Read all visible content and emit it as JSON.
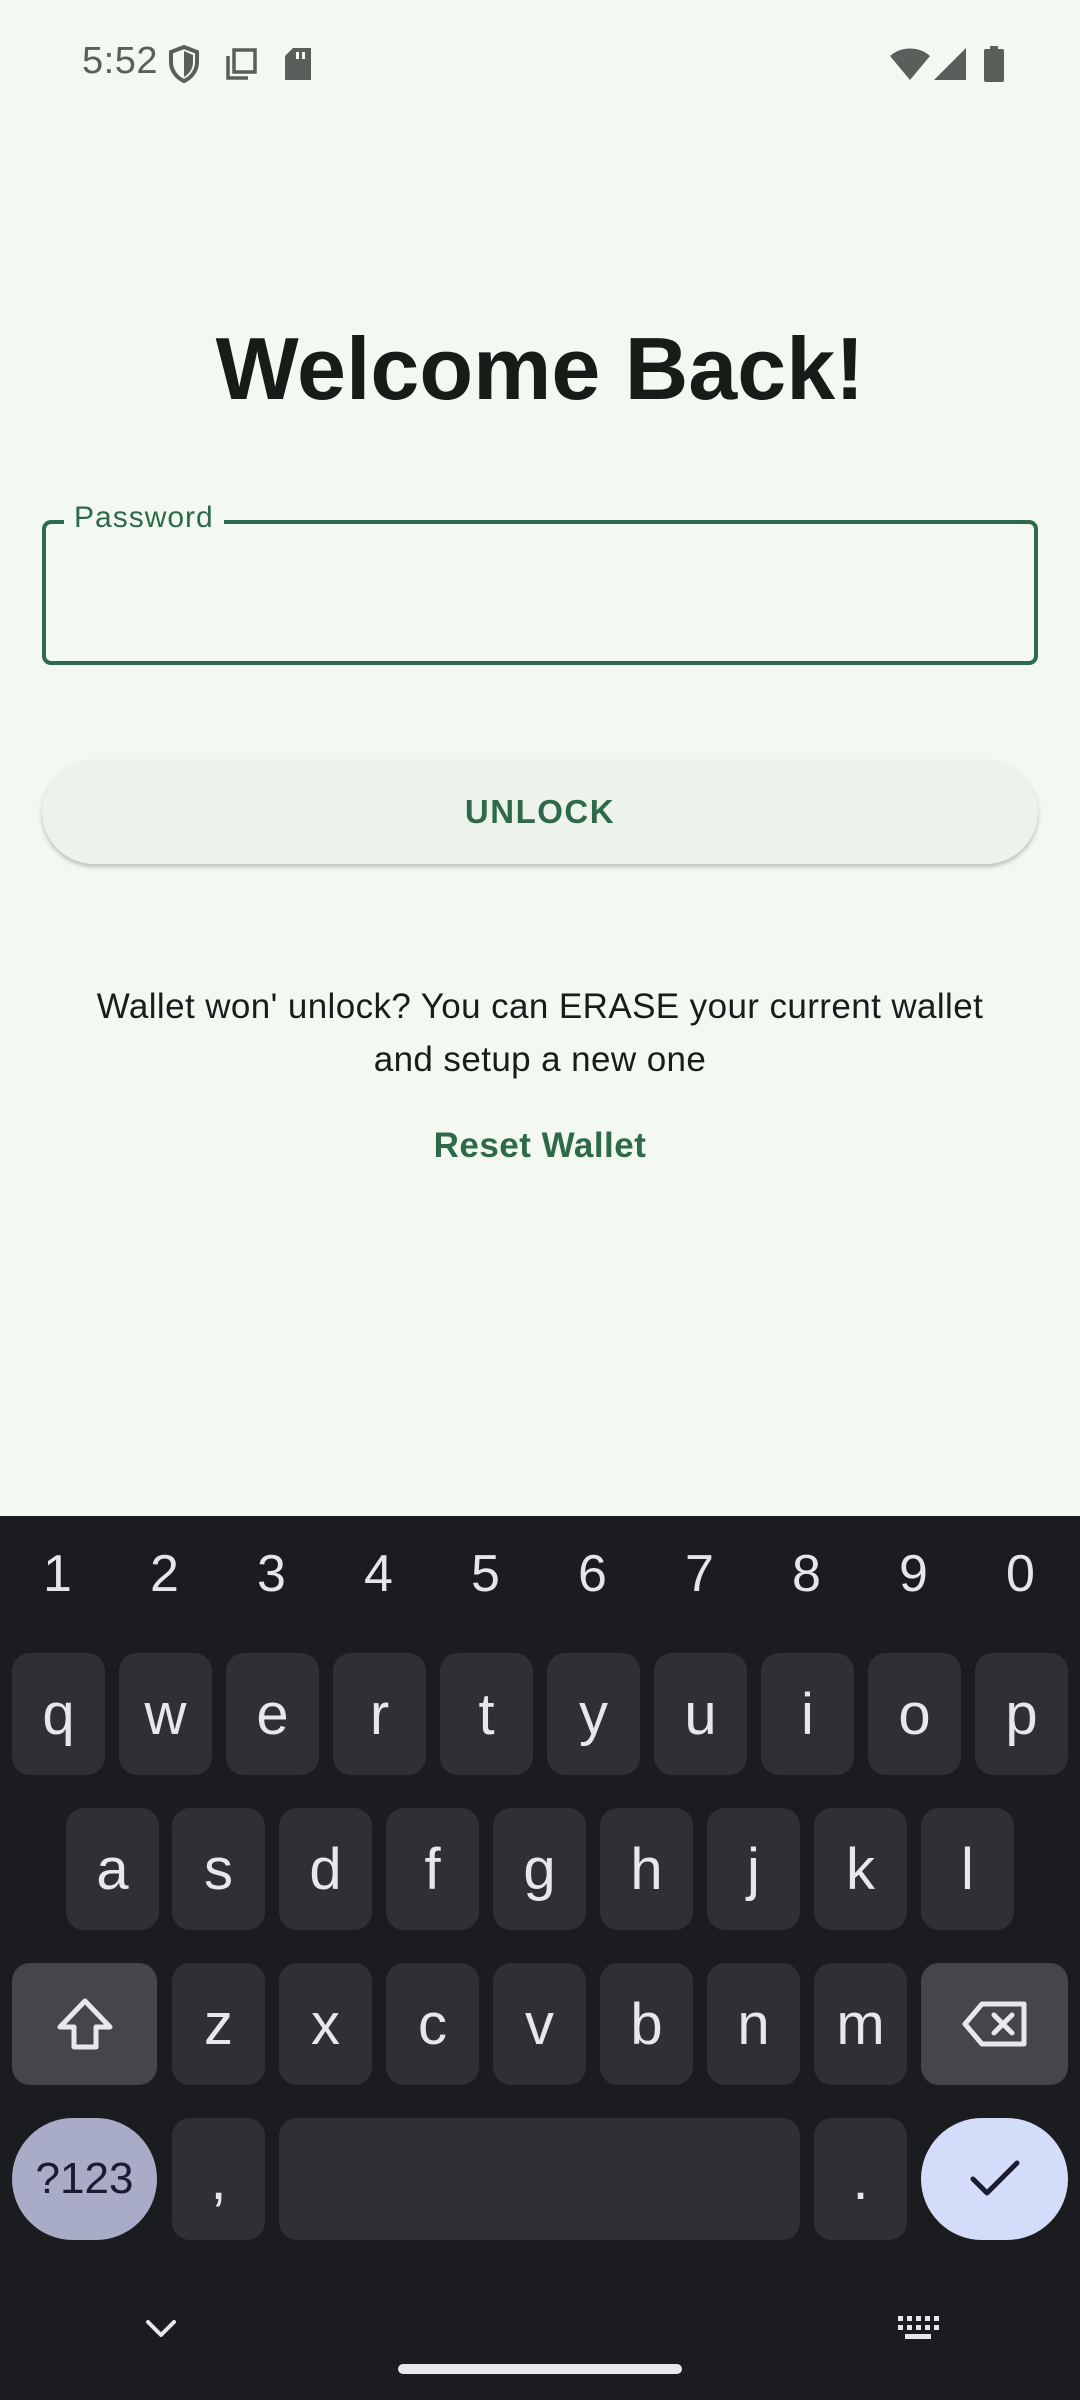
{
  "status_bar": {
    "time": "5:52",
    "left_icons": [
      "shield-icon",
      "copy-icon",
      "sd-card-icon"
    ],
    "right_icons": [
      "wifi-icon",
      "signal-icon",
      "battery-icon"
    ]
  },
  "screen": {
    "title": "Welcome Back!",
    "password_label": "Password",
    "password_value": "",
    "unlock_label": "UNLOCK",
    "info_line1": "Wallet won' unlock? You can ERASE your current wallet",
    "info_line2": "and setup a new one",
    "reset_label": "Reset Wallet"
  },
  "keyboard": {
    "numbers": [
      "1",
      "2",
      "3",
      "4",
      "5",
      "6",
      "7",
      "8",
      "9",
      "0"
    ],
    "row1": [
      "q",
      "w",
      "e",
      "r",
      "t",
      "y",
      "u",
      "i",
      "o",
      "p"
    ],
    "row2": [
      "a",
      "s",
      "d",
      "f",
      "g",
      "h",
      "j",
      "k",
      "l"
    ],
    "row3": [
      "z",
      "x",
      "c",
      "v",
      "b",
      "n",
      "m"
    ],
    "symbols_label": "?123",
    "comma": ",",
    "period": "."
  },
  "colors": {
    "background": "#f3f8f1",
    "accent": "#2d6a4a",
    "keyboard_bg": "#1b1c20",
    "key_bg": "#2f3034"
  }
}
